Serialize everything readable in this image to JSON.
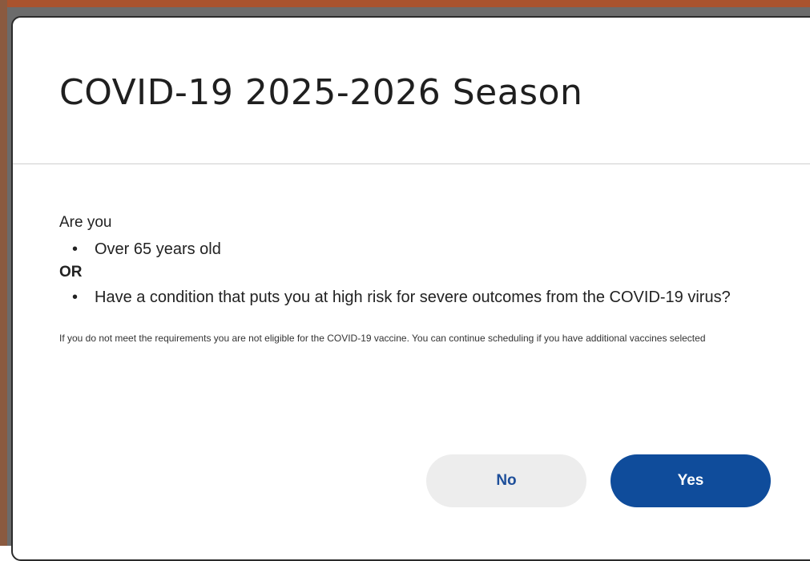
{
  "dialog": {
    "title": "COVID-19 2025-2026 Season",
    "intro": "Are you",
    "criteria_1": "Over 65 years old",
    "separator": "OR",
    "criteria_2": "Have a condition that puts you at high risk for severe outcomes from the COVID-19 virus?",
    "disclaimer": "If you do not meet the requirements you are not eligible for the COVID-19 vaccine. You can continue scheduling if you have additional vaccines selected",
    "buttons": {
      "no": "No",
      "yes": "Yes"
    }
  },
  "colors": {
    "primary": "#0f4c9b",
    "secondary_button_bg": "#ededed",
    "secondary_button_text": "#1e4f9a"
  }
}
